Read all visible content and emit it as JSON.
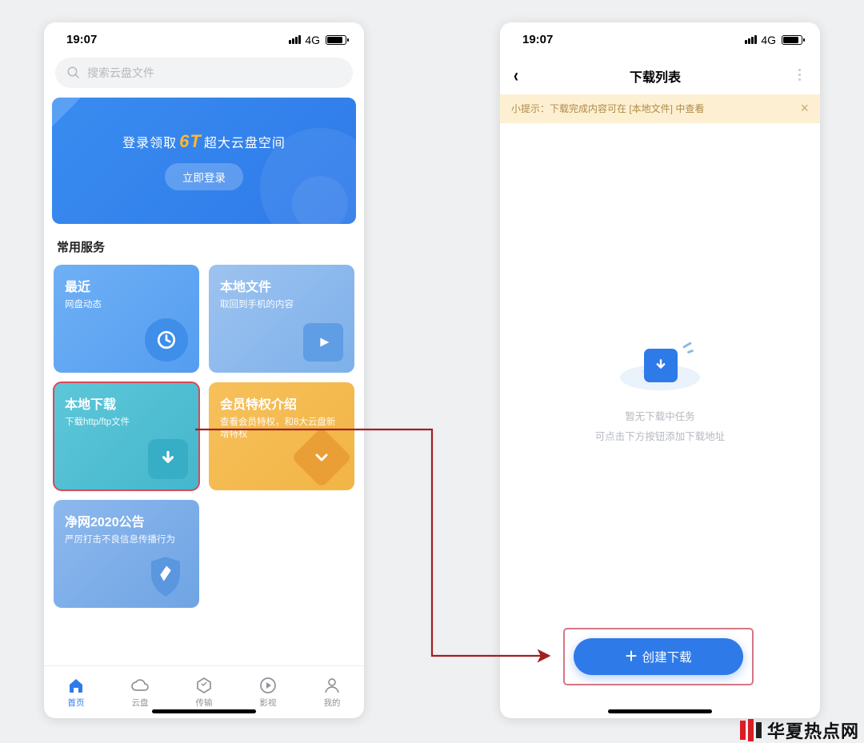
{
  "status": {
    "time": "19:07",
    "signal": "4G"
  },
  "left": {
    "search_placeholder": "搜索云盘文件",
    "banner": {
      "pre": "登录领取",
      "em": "6T",
      "post": "超大云盘空间",
      "button": "立即登录"
    },
    "section_title": "常用服务",
    "cards": {
      "recent": {
        "title": "最近",
        "subtitle": "网盘动态"
      },
      "local": {
        "title": "本地文件",
        "subtitle": "取回到手机的内容"
      },
      "download": {
        "title": "本地下载",
        "subtitle": "下载http/ftp文件"
      },
      "vip": {
        "title": "会员特权介绍",
        "subtitle": "查看会员特权，和8大云盘新增特权"
      },
      "notice": {
        "title": "净网2020公告",
        "subtitle": "严厉打击不良信息传播行为"
      }
    },
    "tabs": {
      "home": "首页",
      "cloud": "云盘",
      "transfer": "传输",
      "media": "影视",
      "mine": "我的"
    }
  },
  "right": {
    "title": "下载列表",
    "tip": "小提示：下载完成内容可在 [本地文件] 中查看",
    "empty_line1": "暂无下载中任务",
    "empty_line2": "可点击下方按钮添加下载地址",
    "create": "创建下载"
  },
  "watermark": "华夏热点网"
}
